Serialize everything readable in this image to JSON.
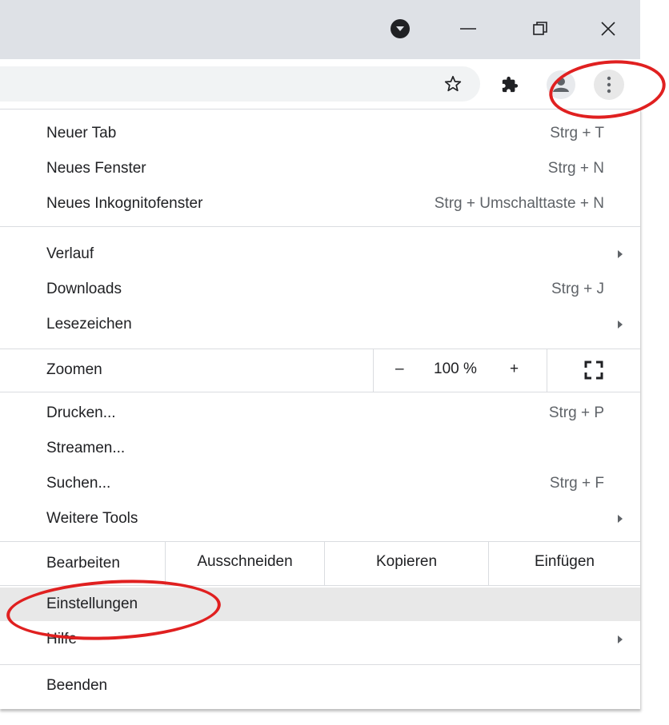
{
  "window_controls": {
    "profile_indicator_icon": "dropdown-circle-icon",
    "minimize": "—",
    "restore": "❐",
    "close": "✕"
  },
  "toolbar": {
    "bookmark_icon": "star-icon",
    "extensions_icon": "puzzle-icon",
    "profile_icon": "person-icon",
    "menu_icon": "kebab-menu-icon"
  },
  "menu": {
    "new_tab": {
      "label": "Neuer Tab",
      "shortcut": "Strg + T"
    },
    "new_window": {
      "label": "Neues Fenster",
      "shortcut": "Strg + N"
    },
    "new_incognito": {
      "label": "Neues Inkognitofenster",
      "shortcut": "Strg + Umschalttaste + N"
    },
    "history": {
      "label": "Verlauf"
    },
    "downloads": {
      "label": "Downloads",
      "shortcut": "Strg + J"
    },
    "bookmarks": {
      "label": "Lesezeichen"
    },
    "zoom": {
      "label": "Zoomen",
      "minus": "–",
      "value": "100 %",
      "plus": "+"
    },
    "print": {
      "label": "Drucken...",
      "shortcut": "Strg + P"
    },
    "cast": {
      "label": "Streamen..."
    },
    "find": {
      "label": "Suchen...",
      "shortcut": "Strg + F"
    },
    "more_tools": {
      "label": "Weitere Tools"
    },
    "edit": {
      "label": "Bearbeiten",
      "cut": "Ausschneiden",
      "copy": "Kopieren",
      "paste": "Einfügen"
    },
    "settings": {
      "label": "Einstellungen"
    },
    "help": {
      "label": "Hilfe"
    },
    "exit": {
      "label": "Beenden"
    }
  },
  "colors": {
    "annotation_ring": "#e02020",
    "highlight": "#e8e8e8",
    "titlebar": "#dee1e6"
  }
}
